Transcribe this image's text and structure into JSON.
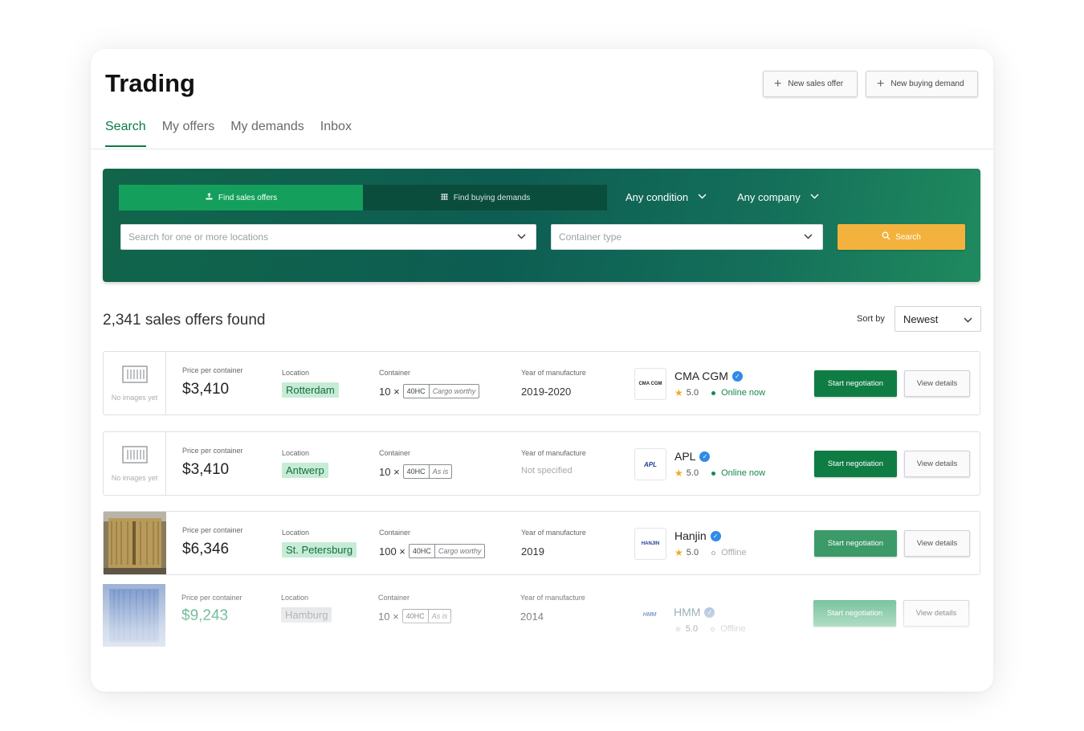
{
  "page": {
    "title": "Trading"
  },
  "header_buttons": {
    "new_sales_offer": "New sales offer",
    "new_buying_demand": "New buying demand"
  },
  "tabs": [
    {
      "label": "Search",
      "active": true
    },
    {
      "label": "My offers",
      "active": false
    },
    {
      "label": "My demands",
      "active": false
    },
    {
      "label": "Inbox",
      "active": false
    }
  ],
  "search": {
    "mode_sales": "Find sales offers",
    "mode_demands": "Find buying demands",
    "condition": "Any condition",
    "company": "Any company",
    "locations_placeholder": "Search for one or more locations",
    "container_placeholder": "Container type",
    "button": "Search"
  },
  "results": {
    "count_text": "2,341 sales offers found",
    "sort_label": "Sort by",
    "sort_value": "Newest"
  },
  "labels": {
    "price": "Price per container",
    "location": "Location",
    "container": "Container",
    "year": "Year of manufacture",
    "no_images": "No images yet",
    "start_negotiation": "Start negotiation",
    "view_details": "View details"
  },
  "offers": [
    {
      "price": "$3,410",
      "location": "Rotterdam",
      "qty": "10 ×",
      "size": "40HC",
      "condition": "Cargo worthy",
      "year": "2019-2020",
      "company": "CMA CGM",
      "logo_text": "CMA CGM",
      "rating": "5.0",
      "status": "Online now",
      "online": true,
      "image": "none"
    },
    {
      "price": "$3,410",
      "location": "Antwerp",
      "qty": "10 ×",
      "size": "40HC",
      "condition": "As is",
      "year": "Not specified",
      "company": "APL",
      "logo_text": "APL",
      "rating": "5.0",
      "status": "Online now",
      "online": true,
      "image": "none"
    },
    {
      "price": "$6,346",
      "location": "St. Petersburg",
      "qty": "100 ×",
      "size": "40HC",
      "condition": "Cargo worthy",
      "year": "2019",
      "company": "Hanjin",
      "logo_text": "HANJIN",
      "rating": "5.0",
      "status": "Offline",
      "online": false,
      "image": "photo-tan"
    },
    {
      "price": "$9,243",
      "location": "Hamburg",
      "qty": "10 ×",
      "size": "40HC",
      "condition": "As is",
      "year": "2014",
      "company": "HMM",
      "logo_text": "HMM",
      "rating": "5.0",
      "status": "Offline",
      "online": false,
      "image": "photo-blue"
    }
  ],
  "colors": {
    "brand_green": "#0f7d43",
    "accent_orange": "#f3b23d",
    "verified_blue": "#2f8be6"
  }
}
